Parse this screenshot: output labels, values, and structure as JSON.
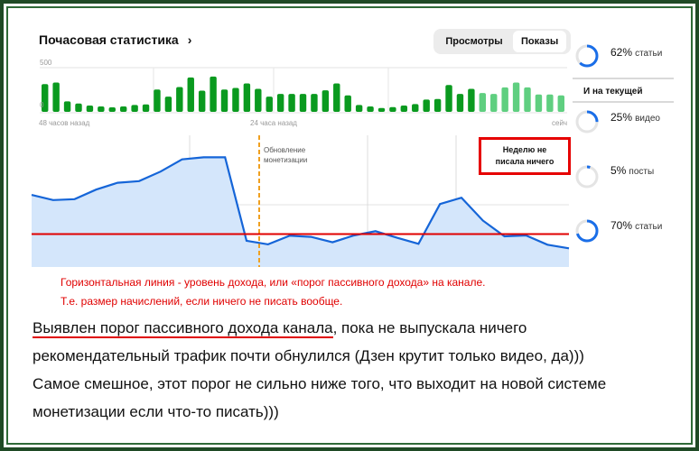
{
  "header": {
    "title": "Почасовая статистика",
    "chevron": "›",
    "tabs": [
      {
        "label": "Просмотры",
        "active": false
      },
      {
        "label": "Показы",
        "active": true
      }
    ]
  },
  "bar_chart": {
    "y_max_label": "500",
    "y_min_label": "0",
    "x_labels": [
      "48 часов назад",
      "24 часа назад",
      "сейч"
    ],
    "values": [
      314,
      331,
      118,
      95,
      71,
      61,
      51,
      61,
      78,
      84,
      253,
      172,
      280,
      389,
      240,
      399,
      253,
      270,
      321,
      260,
      172,
      203,
      203,
      203,
      203,
      243,
      321,
      186,
      78,
      61,
      44,
      54,
      71,
      88,
      139,
      145,
      304,
      203,
      260,
      213,
      203,
      277,
      331,
      277,
      196,
      196,
      186
    ],
    "light_from_index": 39,
    "color": "#0a9a1f",
    "light_color": "#5fcf80"
  },
  "line_chart": {
    "values": [
      54.7,
      50.8,
      51.5,
      58.8,
      64,
      65.2,
      72.5,
      81.7,
      83.3,
      83.3,
      19.9,
      17.2,
      23.8,
      22.9,
      18.8,
      24,
      27.2,
      22.2,
      17.6,
      47.8,
      52.6,
      35.2,
      23.3,
      24,
      16.9,
      14.2
    ],
    "threshold": 25,
    "ylim": [
      0,
      100
    ],
    "line_color": "#1565d8",
    "fill_color": "#d4e6fb",
    "threshold_color": "#e00000",
    "marker_label_1": "Обновление",
    "marker_label_2": "монетизации",
    "annotation_line_1": "Неделю не",
    "annotation_line_2": "писала ничего"
  },
  "right_panel": {
    "top": {
      "percent": "62%",
      "label": "статьи",
      "value": 62
    },
    "section_title": "И на текущей",
    "items": [
      {
        "percent": "25%",
        "label": "видео",
        "value": 25
      },
      {
        "percent": "5%",
        "label": "посты",
        "value": 5
      },
      {
        "percent": "70%",
        "label": "статьи",
        "value": 70
      }
    ]
  },
  "red_note": {
    "line1": "Горизонтальная линия - уровень дохода, или «порог пассивного дохода» на канале.",
    "line2": "Т.е. размер начислений, если ничего не писать вообще."
  },
  "paragraph": {
    "underlined": "Выявлен порог пассивного дохода канала",
    "line1_rest": ", пока не выпускала ничего",
    "line2": "рекомендательный трафик почти обнулился (Дзен крутит только видео, да)))",
    "line3": "Самое смешное, этот порог не сильно ниже того, что выходит на новой системе",
    "line4": "монетизации если что-то писать)))"
  }
}
